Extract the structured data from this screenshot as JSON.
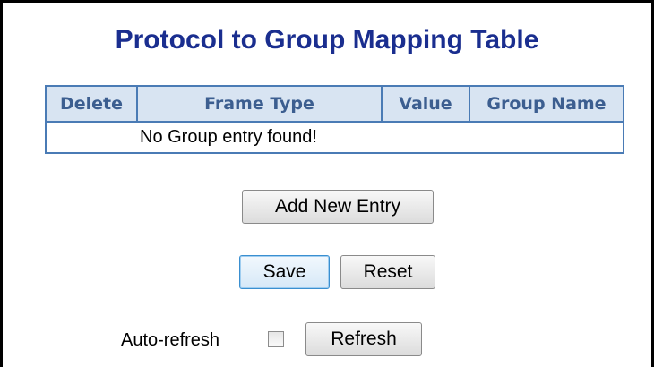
{
  "title": "Protocol to Group Mapping Table",
  "table": {
    "columns": [
      "Delete",
      "Frame Type",
      "Value",
      "Group Name"
    ],
    "empty_message": "No Group entry found!"
  },
  "buttons": {
    "add_new_entry": "Add New Entry",
    "save": "Save",
    "reset": "Reset",
    "refresh": "Refresh"
  },
  "auto_refresh": {
    "label": "Auto-refresh",
    "checked": false
  },
  "colors": {
    "title": "#1a2e8f",
    "table_border": "#4a7bb5",
    "header_bg": "#d8e4f2",
    "header_text": "#3c5e90"
  }
}
